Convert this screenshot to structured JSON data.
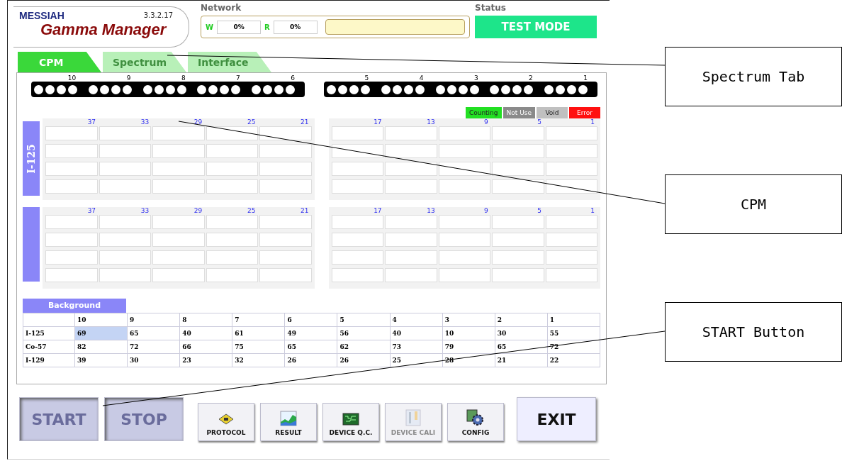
{
  "app": {
    "brand": "MESSIAH",
    "title": "Gamma Manager",
    "version": "3.3.2.17"
  },
  "network": {
    "label": "Network",
    "w_label": "W",
    "w_value": "0%",
    "r_label": "R",
    "r_value": "0%"
  },
  "status": {
    "label": "Status",
    "value": "TEST MODE"
  },
  "tabs": [
    {
      "label": "CPM",
      "selected": true
    },
    {
      "label": "Spectrum",
      "selected": false
    },
    {
      "label": "Interface",
      "selected": false
    }
  ],
  "racks": [
    {
      "numbers": [
        "10",
        "9",
        "8",
        "7",
        "6"
      ]
    },
    {
      "numbers": [
        "5",
        "4",
        "3",
        "2",
        "1"
      ]
    }
  ],
  "legend": [
    {
      "label": "Counting",
      "color": "#22e022"
    },
    {
      "label": "Not Use",
      "color": "#8a8a8a"
    },
    {
      "label": "Void",
      "color": "#c0c0c0"
    },
    {
      "label": "Error",
      "color": "#ff1010"
    }
  ],
  "groups": [
    {
      "label": "I-125",
      "columns": [
        "37",
        "33",
        "29",
        "25",
        "21",
        "17",
        "13",
        "9",
        "5",
        "1"
      ]
    },
    {
      "columns": [
        "37",
        "33",
        "29",
        "25",
        "21",
        "17",
        "13",
        "9",
        "5",
        "1"
      ]
    }
  ],
  "background": {
    "title": "Background",
    "columns": [
      "10",
      "9",
      "8",
      "7",
      "6",
      "5",
      "4",
      "3",
      "2",
      "1"
    ],
    "rows": [
      {
        "label": "I-125",
        "cells": [
          {
            "value": "69",
            "selected": true
          },
          {
            "value": "65",
            "selected": false
          },
          {
            "value": "40",
            "selected": false
          },
          {
            "value": "61",
            "selected": false
          },
          {
            "value": "49",
            "selected": false
          },
          {
            "value": "56",
            "selected": false
          },
          {
            "value": "40",
            "selected": false
          },
          {
            "value": "10",
            "selected": false
          },
          {
            "value": "30",
            "selected": false
          },
          {
            "value": "55",
            "selected": false
          }
        ]
      },
      {
        "label": "Co-57",
        "cells": [
          {
            "value": "82",
            "selected": false
          },
          {
            "value": "72",
            "selected": false
          },
          {
            "value": "66",
            "selected": false
          },
          {
            "value": "75",
            "selected": false
          },
          {
            "value": "65",
            "selected": false
          },
          {
            "value": "62",
            "selected": false
          },
          {
            "value": "73",
            "selected": false
          },
          {
            "value": "79",
            "selected": false
          },
          {
            "value": "65",
            "selected": false
          },
          {
            "value": "72",
            "selected": false
          }
        ]
      },
      {
        "label": "I-129",
        "cells": [
          {
            "value": "39",
            "selected": false
          },
          {
            "value": "30",
            "selected": false
          },
          {
            "value": "23",
            "selected": false
          },
          {
            "value": "32",
            "selected": false
          },
          {
            "value": "26",
            "selected": false
          },
          {
            "value": "26",
            "selected": false
          },
          {
            "value": "25",
            "selected": false
          },
          {
            "value": "28",
            "selected": false
          },
          {
            "value": "21",
            "selected": false
          },
          {
            "value": "22",
            "selected": false
          }
        ]
      }
    ]
  },
  "buttons": [
    {
      "label": "START",
      "kind": "big",
      "disabled": true
    },
    {
      "label": "STOP",
      "kind": "big",
      "disabled": true
    },
    {
      "label": "PROTOCOL",
      "kind": "icon",
      "disabled": false
    },
    {
      "label": "RESULT",
      "kind": "icon",
      "disabled": false
    },
    {
      "label": "DEVICE Q.C.",
      "kind": "icon",
      "disabled": false
    },
    {
      "label": "DEVICE CALI",
      "kind": "icon",
      "disabled": true
    },
    {
      "label": "CONFIG",
      "kind": "icon",
      "disabled": false
    },
    {
      "label": "EXIT",
      "kind": "big",
      "disabled": false
    }
  ],
  "callouts": [
    {
      "label": "Spectrum Tab"
    },
    {
      "label": "CPM"
    },
    {
      "label": "START Button"
    }
  ]
}
